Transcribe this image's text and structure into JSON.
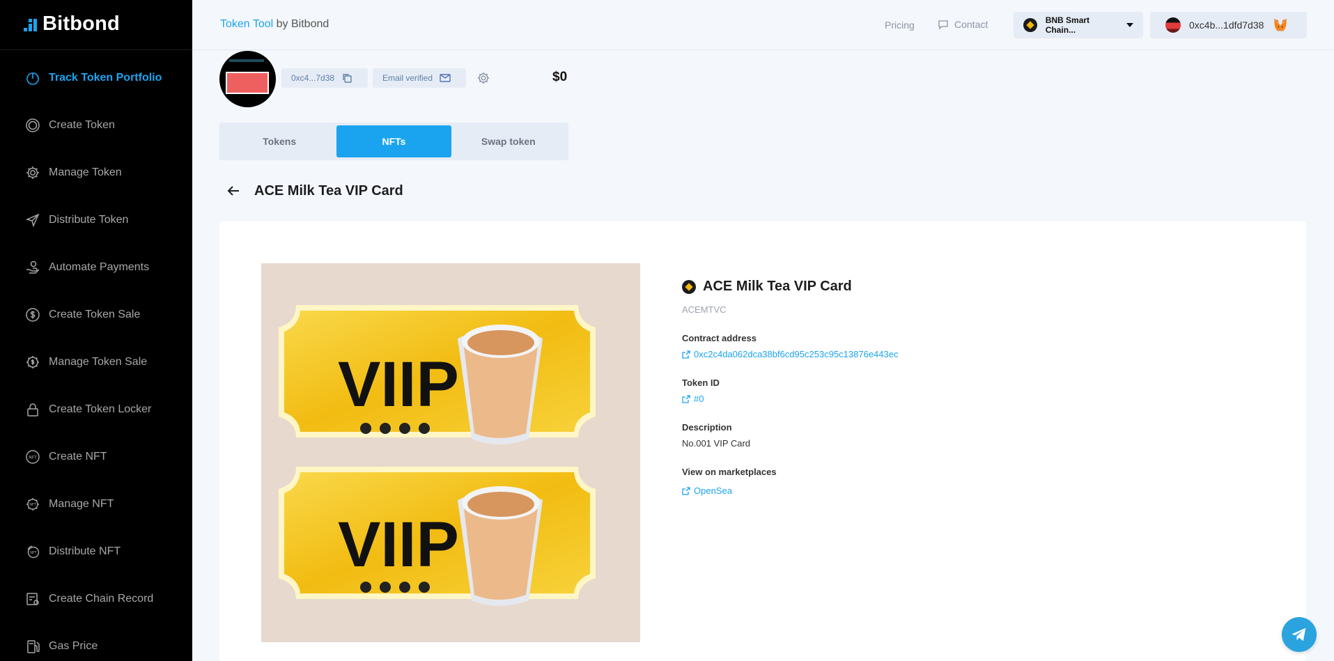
{
  "sidebar": {
    "logo": "Bitbond",
    "items": [
      {
        "label": "Track Token Portfolio",
        "icon": "portfolio-icon",
        "active": true
      },
      {
        "label": "Create Token",
        "icon": "coin-icon",
        "active": false
      },
      {
        "label": "Manage Token",
        "icon": "gear-icon",
        "active": false
      },
      {
        "label": "Distribute Token",
        "icon": "send-icon",
        "active": false
      },
      {
        "label": "Automate Payments",
        "icon": "hand-coin-icon",
        "active": false
      },
      {
        "label": "Create Token Sale",
        "icon": "dollar-coin-icon",
        "active": false
      },
      {
        "label": "Manage Token Sale",
        "icon": "gear-dollar-icon",
        "active": false
      },
      {
        "label": "Create Token Locker",
        "icon": "lock-icon",
        "active": false
      },
      {
        "label": "Create NFT",
        "icon": "nft-icon",
        "active": false
      },
      {
        "label": "Manage NFT",
        "icon": "gear-nft-icon",
        "active": false
      },
      {
        "label": "Distribute NFT",
        "icon": "distribute-nft-icon",
        "active": false
      },
      {
        "label": "Create Chain Record",
        "icon": "record-icon",
        "active": false
      },
      {
        "label": "Gas Price",
        "icon": "gas-pump-icon",
        "active": false
      }
    ]
  },
  "header": {
    "brand_accent": "Token Tool",
    "brand_rest": " by Bitbond",
    "pricing": "Pricing",
    "contact": "Contact",
    "chain": "BNB Smart Chain...",
    "wallet": "0xc4b...1dfd7d38"
  },
  "profile": {
    "address_short": "0xc4...7d38",
    "email_status": "Email verified",
    "balance": "$0"
  },
  "tabs": [
    {
      "label": "Tokens",
      "active": false
    },
    {
      "label": "NFTs",
      "active": true
    },
    {
      "label": "Swap token",
      "active": false
    }
  ],
  "page": {
    "title": "ACE Milk Tea VIP Card"
  },
  "nft": {
    "name": "ACE Milk Tea VIP Card",
    "symbol": "ACEMTVC",
    "contract_label": "Contract address",
    "contract_address": "0xc2c4da062dca38bf6cd95c253c95c13876e443ec",
    "token_id_label": "Token ID",
    "token_id": "#0",
    "description_label": "Description",
    "description": "No.001 VIP Card",
    "marketplaces_label": "View on marketplaces",
    "marketplace": "OpenSea",
    "image_text": "VIIP",
    "colors": {
      "ticket": "#f5c518",
      "background": "#e7d9ce"
    }
  },
  "colors": {
    "accent": "#1aa4f0",
    "sidebar": "#000000"
  }
}
